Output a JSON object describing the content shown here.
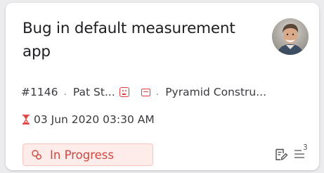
{
  "ticket": {
    "title": "Bug in default measurement app",
    "id": "#1146",
    "contact": "Pat St...",
    "account": "Pyramid Constru...",
    "due_date": "03 Jun 2020 03:30 AM",
    "status": "In Progress",
    "thread_count": "3"
  },
  "icons": {
    "priority": "sad-face-icon",
    "channel": "ticket-icon",
    "due": "hourglass-icon",
    "status": "status-circle-icon",
    "edit": "edit-note-icon",
    "threads": "list-lines-icon"
  },
  "colors": {
    "status_text": "#d0473f",
    "status_background": "#fdecea",
    "accent_red": "#e0403c",
    "text_primary": "#1e1e22"
  }
}
